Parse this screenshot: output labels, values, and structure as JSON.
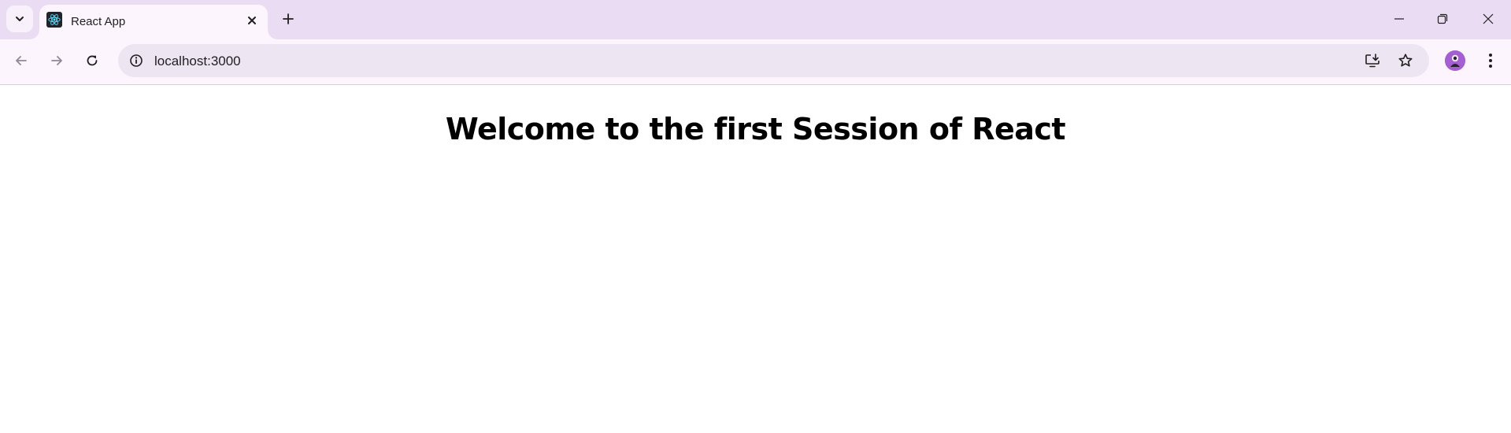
{
  "browser": {
    "tab": {
      "title": "React App",
      "favicon": "react-logo-icon"
    },
    "address_bar": {
      "url": "localhost:3000"
    },
    "colors": {
      "tabstrip": "#e9dcf3",
      "toolbar": "#fcf5fe",
      "omnibox": "#ede5f2",
      "avatar": "#a45fd1",
      "react_logo": "#61dafb"
    }
  },
  "page": {
    "heading": "Welcome to the first Session of React"
  }
}
